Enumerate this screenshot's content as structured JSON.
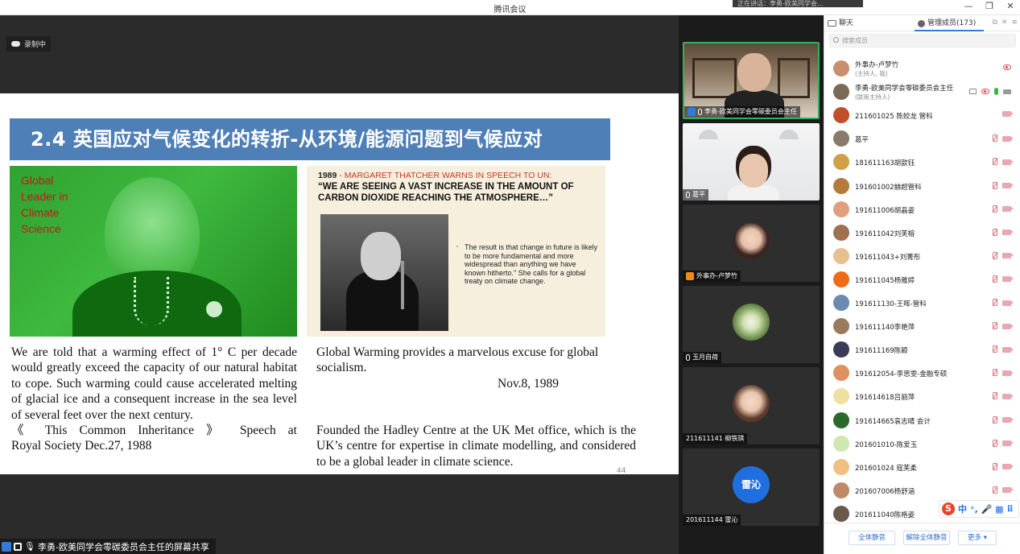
{
  "window": {
    "title": "腾讯会议",
    "tip": "正在讲话：李勇-欧美同学会…"
  },
  "recording": {
    "label": "录制中"
  },
  "slide": {
    "banner": "2.4 英国应对气候变化的转折-从环境/能源问题到气候应对",
    "image_label_lines": [
      "Global",
      "Leader in",
      "Climate",
      "Science"
    ],
    "quote_year": "1989",
    "quote_head": " - MARGARET THATCHER WARNS IN SPEECH TO UN:",
    "quote_main": "“WE ARE SEEING A VAST INCREASE IN THE AMOUNT OF CARBON DIOXIDE REACHING THE ATMOSPHERE…”",
    "quote_bullet": "The result is that change in future is likely to be more fundamental and more widespread than anything we have known hitherto.\" She calls for a global treaty on climate change.",
    "left_para": "We are told that a warming effect of 1° C per decade would greatly exceed the capacity of our natural habitat to cope. Such warming could cause accelerated melting of glacial ice and a consequent increase in the sea level of several feet over the next century.",
    "left_cite1": "《 This Common Inheritance 》 Speech at",
    "left_cite2": "Royal Society   Dec.27, 1988",
    "right_para1": "Global Warming provides a marvelous excuse for global socialism.",
    "right_date": "Nov.8, 1989",
    "right_para2": "Founded the Hadley Centre at the UK Met office, which is the UK’s centre for expertise in climate modelling, and considered to be a global leader in climate science.",
    "page_number": "44"
  },
  "share_bar": {
    "label": "李勇-欧美同学会零碳委员会主任的屏幕共享"
  },
  "videos": [
    {
      "name": "李勇-欧美同学会零碳委员会主任"
    },
    {
      "name": "葛平"
    },
    {
      "name": "外事办-卢梦竹"
    },
    {
      "name": "玉月自荷"
    },
    {
      "name": "211611141 柳铁琪"
    },
    {
      "name": "201611144 雷沁",
      "avatar_text": "雷沁"
    }
  ],
  "panel": {
    "tab_chat": "聊天",
    "tab_members": "管理成员(173)",
    "search_placeholder": "搜索成员",
    "members": [
      {
        "name": "外事办-卢梦竹",
        "sub": "(主持人, 我)",
        "color": "#c98f6e"
      },
      {
        "name": "李勇-欧美同学会零碳委员会主任",
        "sub": "(联席主持人)",
        "color": "#7a6a5a"
      },
      {
        "name": "211601025 陈姣龙 管科",
        "color": "#c0502a"
      },
      {
        "name": "葛平",
        "color": "#8a7a6a"
      },
      {
        "name": "181611163胡歆钰",
        "color": "#d2a04a"
      },
      {
        "name": "191601002赫超管科",
        "color": "#b87a3a"
      },
      {
        "name": "191611006胡晶姿",
        "color": "#e0a080"
      },
      {
        "name": "191611042刘芙榕",
        "color": "#a07050"
      },
      {
        "name": "191611043+刘菁彤",
        "color": "#e8c090"
      },
      {
        "name": "191611045杨雅婷",
        "color": "#f06a1a"
      },
      {
        "name": "191611130-王晖-管科",
        "color": "#6a8ab0"
      },
      {
        "name": "191611140李艳萍",
        "color": "#9a7a5a"
      },
      {
        "name": "191611169陈颖",
        "color": "#3a3a5a"
      },
      {
        "name": "191612054-李思雯-金融专硕",
        "color": "#e09060"
      },
      {
        "name": "191614618吕丽萍",
        "color": "#f0e0a0"
      },
      {
        "name": "191614665袁志晴 会计",
        "color": "#2a6a2a"
      },
      {
        "name": "201601010-陈爱玉",
        "color": "#d0e8b0"
      },
      {
        "name": "201601024 寇芙柔",
        "color": "#f0c080"
      },
      {
        "name": "201607006杨舒涵",
        "color": "#c08a6a"
      },
      {
        "name": "201611040陈格姿",
        "color": "#6a5a4a"
      }
    ],
    "footer_buttons": [
      "全体静音",
      "解除全体静音",
      "更多 ▾"
    ]
  },
  "ime": {
    "logo": "S",
    "text": "中 ⁺, 🎤 ▦ ⠿"
  }
}
